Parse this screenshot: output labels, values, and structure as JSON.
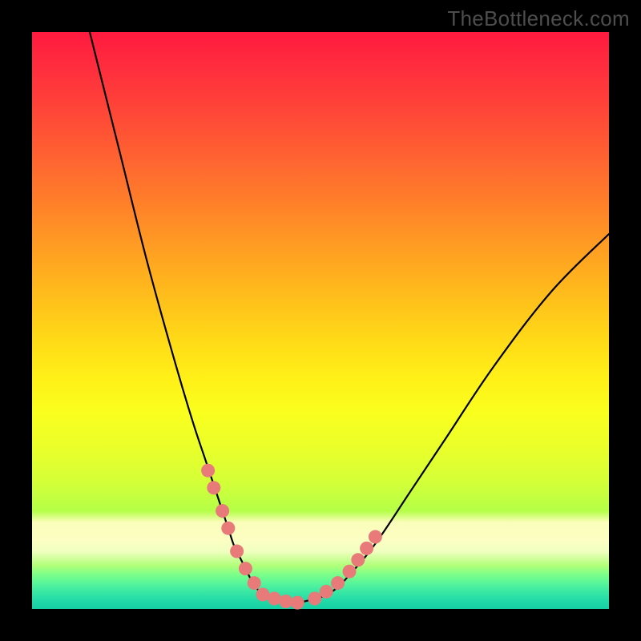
{
  "watermark": "TheBottleneck.com",
  "chart_data": {
    "type": "line",
    "title": "",
    "xlabel": "",
    "ylabel": "",
    "xlim": [
      0,
      100
    ],
    "ylim": [
      0,
      100
    ],
    "series": [
      {
        "name": "curve",
        "x": [
          10,
          15,
          20,
          25,
          28,
          30,
          32,
          34,
          35,
          36,
          37,
          38,
          39,
          40,
          41,
          43,
          45,
          48,
          52,
          56,
          60,
          66,
          72,
          80,
          90,
          100
        ],
        "y": [
          100,
          80,
          60,
          42,
          32,
          26,
          20,
          14,
          11,
          9,
          7,
          5,
          3.5,
          2.5,
          2,
          1.5,
          1,
          1.5,
          3,
          7,
          12,
          21,
          30,
          42,
          55,
          65
        ]
      }
    ],
    "highlight_dots": {
      "name": "dash-markers",
      "color": "#e87a7a",
      "x": [
        30.5,
        31.5,
        33.0,
        34.0,
        35.5,
        37.0,
        38.5,
        40.0,
        42.0,
        44.0,
        46.0,
        49.0,
        51.0,
        53.0,
        55.0,
        56.5,
        58.0,
        59.5
      ],
      "y": [
        24.0,
        21.0,
        17.0,
        14.0,
        10.0,
        7.0,
        4.5,
        2.5,
        1.8,
        1.3,
        1.1,
        1.8,
        3.0,
        4.5,
        6.5,
        8.5,
        10.5,
        12.5
      ]
    },
    "background_gradient": {
      "top": "#ff1a3f",
      "mid": "#ffe21a",
      "bottom": "#15d0a4"
    }
  }
}
